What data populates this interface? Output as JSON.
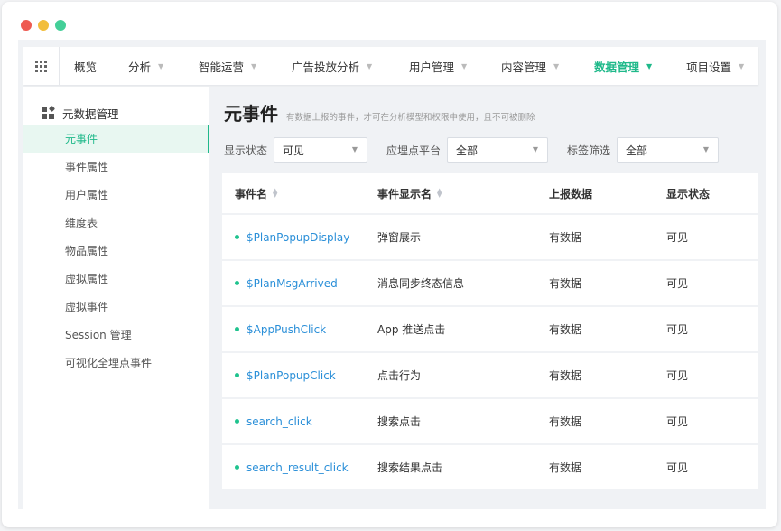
{
  "window": {
    "colors": {
      "close": "#ee5b52",
      "minimize": "#f2be3c",
      "maximize": "#43cf98",
      "accent": "#1fb98a",
      "link": "#2a8fd8"
    }
  },
  "topnav": {
    "grid_icon": "apps-grid-icon",
    "items": [
      {
        "label": "概览",
        "dropdown": false,
        "active": false
      },
      {
        "label": "分析",
        "dropdown": true,
        "active": false
      },
      {
        "label": "智能运营",
        "dropdown": true,
        "active": false
      },
      {
        "label": "广告投放分析",
        "dropdown": true,
        "active": false
      },
      {
        "label": "用户管理",
        "dropdown": true,
        "active": false
      },
      {
        "label": "内容管理",
        "dropdown": true,
        "active": false
      },
      {
        "label": "数据管理",
        "dropdown": true,
        "active": true
      },
      {
        "label": "项目设置",
        "dropdown": true,
        "active": false
      }
    ]
  },
  "sidebar": {
    "header": {
      "icon": "metadata-icon",
      "label": "元数据管理"
    },
    "items": [
      {
        "label": "元事件",
        "active": true
      },
      {
        "label": "事件属性",
        "active": false
      },
      {
        "label": "用户属性",
        "active": false
      },
      {
        "label": "维度表",
        "active": false
      },
      {
        "label": "物品属性",
        "active": false
      },
      {
        "label": "虚拟属性",
        "active": false
      },
      {
        "label": "虚拟事件",
        "active": false
      },
      {
        "label": "Session 管理",
        "active": false
      },
      {
        "label": "可视化全埋点事件",
        "active": false
      }
    ]
  },
  "main": {
    "title": "元事件",
    "subtitle": "有数据上报的事件，才可在分析模型和权限中使用，且不可被删除",
    "filters": {
      "display_status": {
        "label": "显示状态",
        "value": "可见"
      },
      "platform": {
        "label": "应埋点平台",
        "value": "全部"
      },
      "tag": {
        "label": "标签筛选",
        "value": "全部"
      }
    },
    "table": {
      "columns": [
        "事件名",
        "事件显示名",
        "上报数据",
        "显示状态"
      ],
      "rows": [
        {
          "name": "$PlanPopupDisplay",
          "display": "弹窗展示",
          "reported": "有数据",
          "status": "可见"
        },
        {
          "name": "$PlanMsgArrived",
          "display": "消息同步终态信息",
          "reported": "有数据",
          "status": "可见"
        },
        {
          "name": "$AppPushClick",
          "display": "App 推送点击",
          "reported": "有数据",
          "status": "可见"
        },
        {
          "name": "$PlanPopupClick",
          "display": "点击行为",
          "reported": "有数据",
          "status": "可见"
        },
        {
          "name": "search_click",
          "display": "搜索点击",
          "reported": "有数据",
          "status": "可见"
        },
        {
          "name": "search_result_click",
          "display": "搜索结果点击",
          "reported": "有数据",
          "status": "可见"
        }
      ]
    }
  }
}
